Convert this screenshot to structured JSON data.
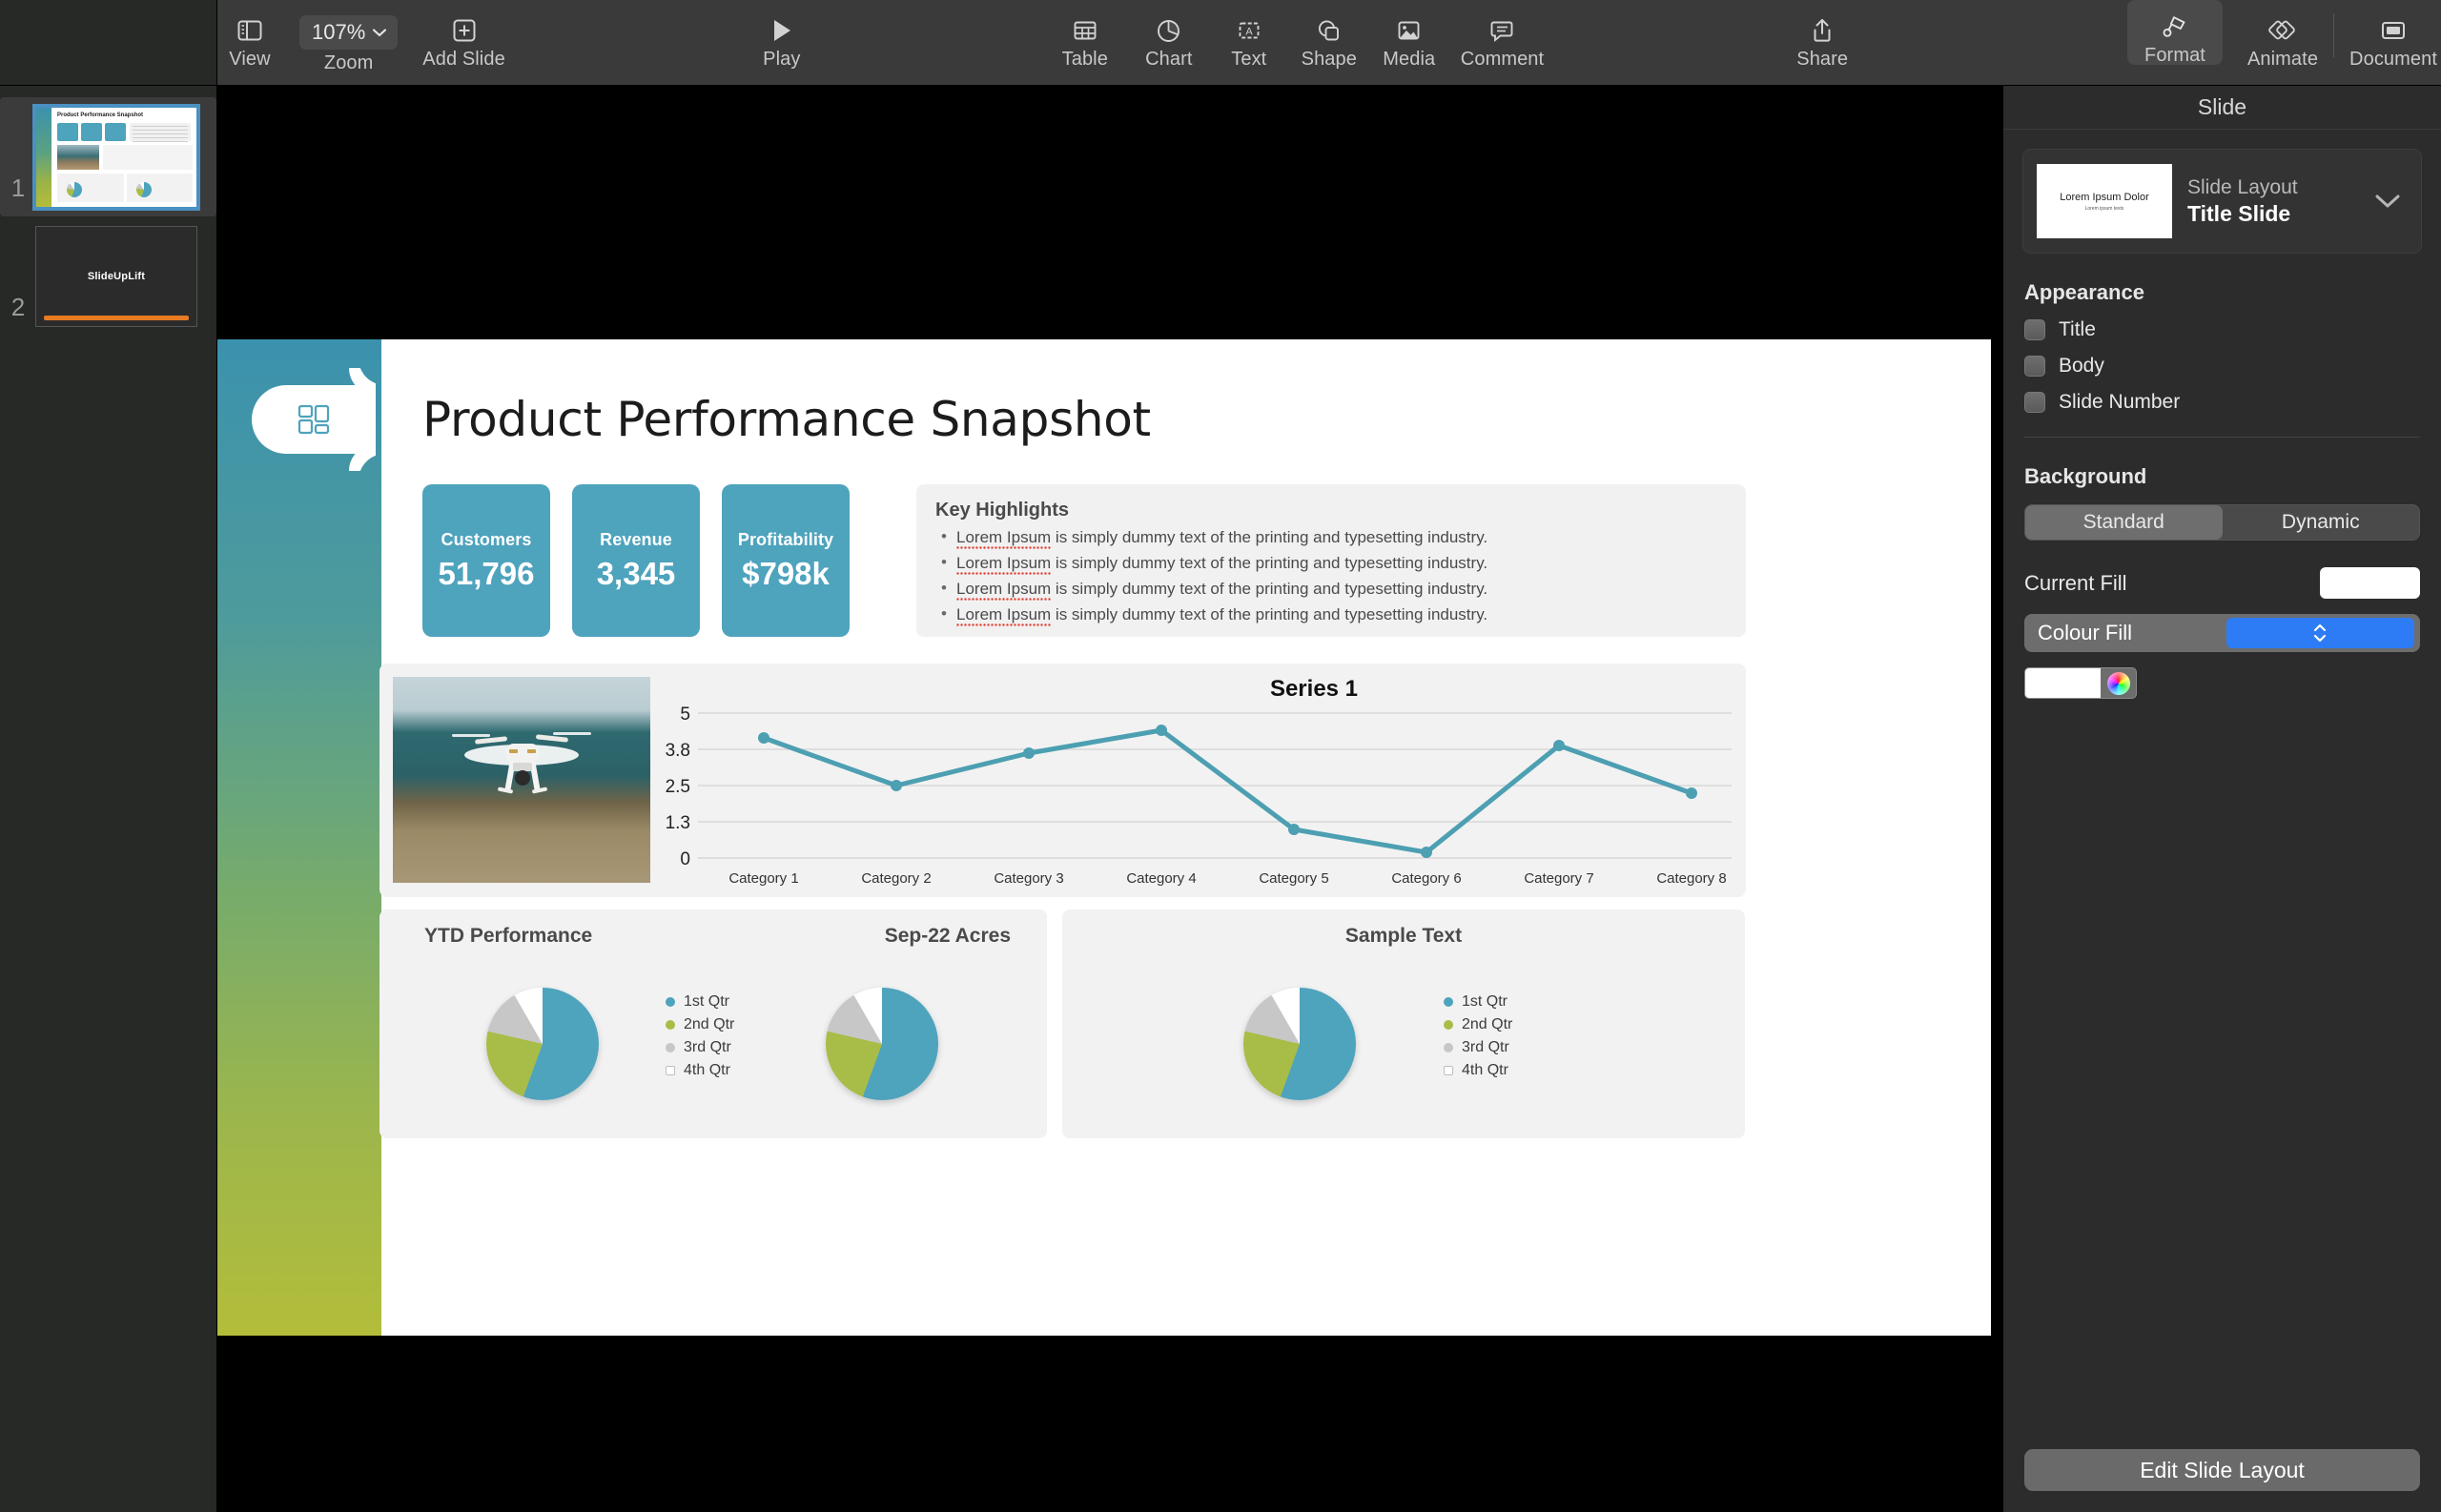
{
  "toolbar": {
    "view_label": "View",
    "zoom_label": "Zoom",
    "zoom_value": "107%",
    "add_slide_label": "Add Slide",
    "play_label": "Play",
    "table_label": "Table",
    "chart_label": "Chart",
    "text_label": "Text",
    "shape_label": "Shape",
    "media_label": "Media",
    "comment_label": "Comment",
    "share_label": "Share",
    "format_label": "Format",
    "animate_label": "Animate",
    "document_label": "Document"
  },
  "navigator": {
    "slides": [
      {
        "number": "1",
        "title": "Product Performance Snapshot",
        "selected": true
      },
      {
        "number": "2",
        "title": "SlideUpLift",
        "selected": false
      }
    ]
  },
  "inspector": {
    "panel_title": "Slide",
    "layout": {
      "caption": "Slide Layout",
      "value": "Title Slide",
      "thumb_title": "Lorem Ipsum Dolor",
      "thumb_sub": "Lorem ipsum texts"
    },
    "appearance": {
      "section_title": "Appearance",
      "items": [
        {
          "label": "Title",
          "checked": false
        },
        {
          "label": "Body",
          "checked": false
        },
        {
          "label": "Slide Number",
          "checked": false
        }
      ]
    },
    "background": {
      "section_title": "Background",
      "segments": [
        {
          "label": "Standard",
          "active": true
        },
        {
          "label": "Dynamic",
          "active": false
        }
      ],
      "current_fill_label": "Current Fill",
      "current_fill_color": "#ffffff",
      "fill_type": "Colour Fill",
      "fill_color": "#ffffff"
    },
    "edit_layout_button": "Edit Slide Layout"
  },
  "slide": {
    "title": "Product Performance Snapshot",
    "accent_gradient_top": "#3b92ad",
    "accent_gradient_bottom": "#b3bd3a",
    "kpis": [
      {
        "label": "Customers",
        "value": "51,796"
      },
      {
        "label": "Revenue",
        "value": "3,345"
      },
      {
        "label": "Profitability",
        "value": "$798k"
      }
    ],
    "key_highlights": {
      "title": "Key Highlights",
      "bullets": [
        {
          "misspelled": "Lorem Ipsum",
          "rest": " is simply dummy text of the printing and typesetting industry."
        },
        {
          "misspelled": "Lorem Ipsum",
          "rest": " is simply dummy text of the printing and typesetting industry."
        },
        {
          "misspelled": "Lorem Ipsum",
          "rest": " is simply dummy text of the printing and typesetting industry."
        },
        {
          "misspelled": "Lorem Ipsum",
          "rest": " is simply dummy text of the printing and typesetting industry."
        }
      ]
    },
    "pie_cards": [
      {
        "title": "YTD Performance"
      },
      {
        "title": "Sep-22 Acres"
      },
      {
        "title": "Sample Text"
      }
    ]
  },
  "chart_data": [
    {
      "type": "line",
      "title": "Series 1",
      "categories": [
        "Category 1",
        "Category 2",
        "Category 3",
        "Category 4",
        "Category 5",
        "Category 6",
        "Category 7",
        "Category 8"
      ],
      "series": [
        {
          "name": "Series 1",
          "values": [
            4.3,
            2.5,
            3.55,
            4.5,
            1.55,
            0.7,
            3.9,
            2.35
          ],
          "color": "#4d9fb2"
        }
      ],
      "ylabel": "",
      "xlabel": "",
      "ylim": [
        0,
        5
      ],
      "yticks": [
        "0",
        "1.3",
        "2.5",
        "3.8",
        "5"
      ],
      "grid": true,
      "legend": "none"
    },
    {
      "type": "pie",
      "title": "YTD Performance",
      "categories": [
        "1st Qtr",
        "2nd Qtr",
        "3rd Qtr",
        "4th Qtr"
      ],
      "values": [
        55.6,
        23.1,
        13.1,
        8.2
      ],
      "colors": [
        "#4ea3bd",
        "#a8bd48",
        "#c7c7c7",
        "#ffffff"
      ],
      "legend": "right"
    },
    {
      "type": "pie",
      "title": "Sep-22 Acres",
      "categories": [
        "1st Qtr",
        "2nd Qtr",
        "3rd Qtr",
        "4th Qtr"
      ],
      "values": [
        55.6,
        23.1,
        13.1,
        8.2
      ],
      "colors": [
        "#4ea3bd",
        "#a8bd48",
        "#c7c7c7",
        "#ffffff"
      ],
      "legend": "none"
    },
    {
      "type": "pie",
      "title": "Sample Text",
      "categories": [
        "1st Qtr",
        "2nd Qtr",
        "3rd Qtr",
        "4th Qtr"
      ],
      "values": [
        55.6,
        23.1,
        13.1,
        8.2
      ],
      "colors": [
        "#4ea3bd",
        "#a8bd48",
        "#c7c7c7",
        "#ffffff"
      ],
      "legend": "right"
    }
  ]
}
